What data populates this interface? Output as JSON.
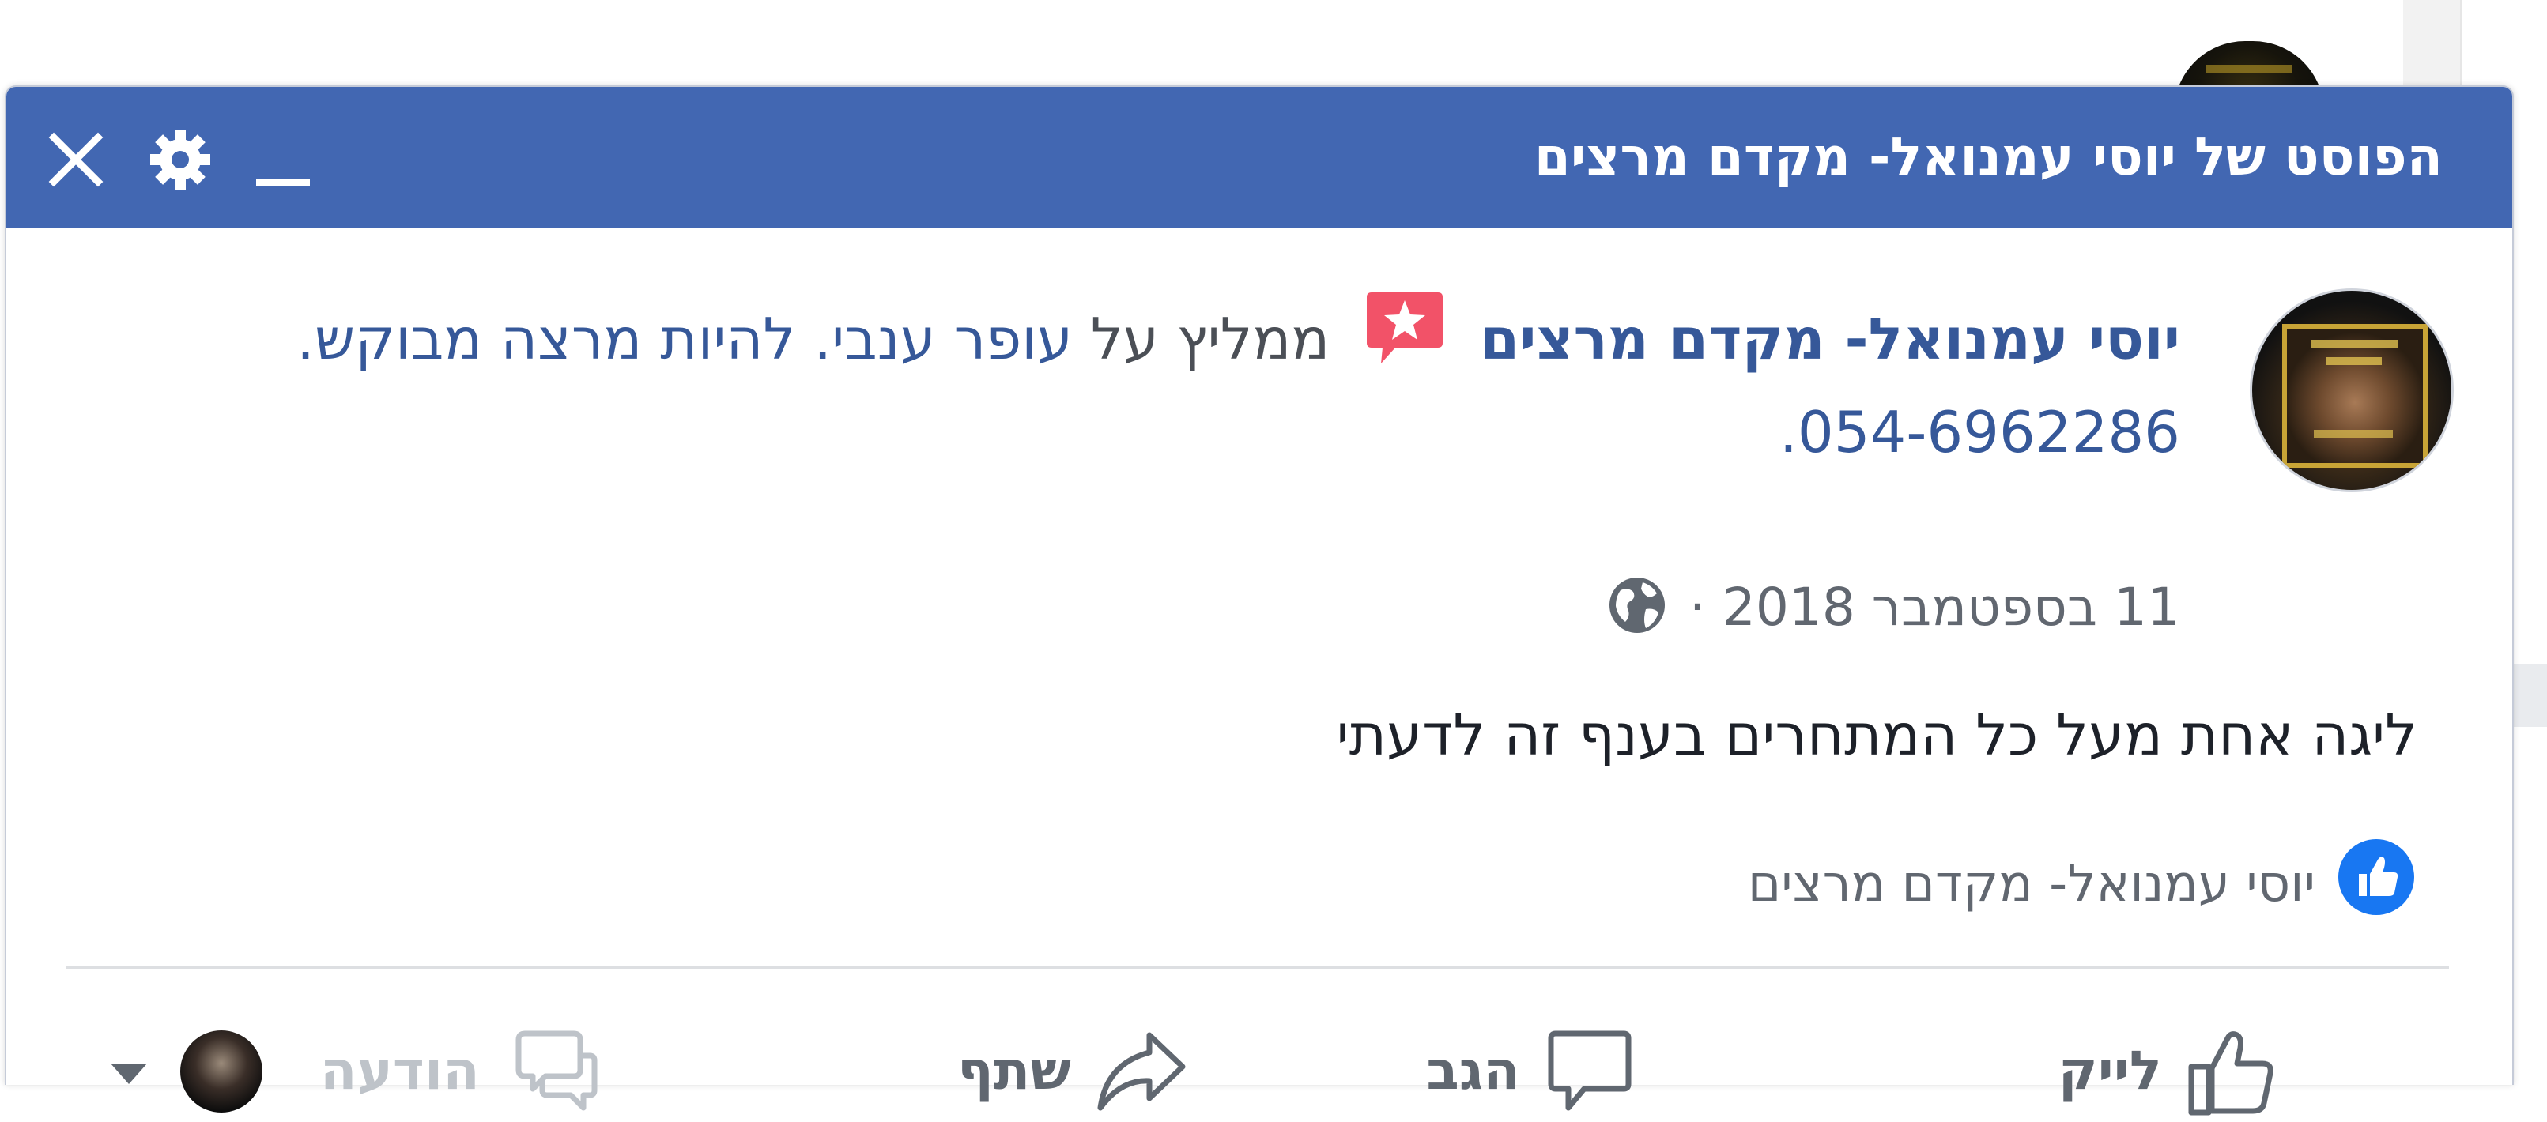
{
  "popup": {
    "title": "הפוסט של יוסי עמנואל- מקדם מרצים",
    "controls": {
      "minimize_icon": "minimize-icon",
      "settings_icon": "gear-icon",
      "close_icon": "close-icon"
    }
  },
  "post": {
    "author": "יוסי עמנואל- מקדם מרצים",
    "recommends_text": "ממליץ על",
    "recommendation": "עופר ענבי. להיות מרצה מבוקש. 054-6962286.",
    "date": "11 בספטמבר 2018",
    "separator": "·",
    "privacy_icon": "globe-icon",
    "text": "ליגה אחת מעל כל המתחרים בענף זה לדעתי"
  },
  "reactions": {
    "icon": "like-icon",
    "likers": "יוסי עמנואל- מקדם מרצים"
  },
  "actions": {
    "like": "לייק",
    "comment": "הגב",
    "share": "שתף",
    "message": "הודעה"
  },
  "colors": {
    "header_blue": "#4267b2",
    "link_blue": "#365899",
    "badge_red": "#f25268",
    "like_blue": "#1877f2"
  }
}
